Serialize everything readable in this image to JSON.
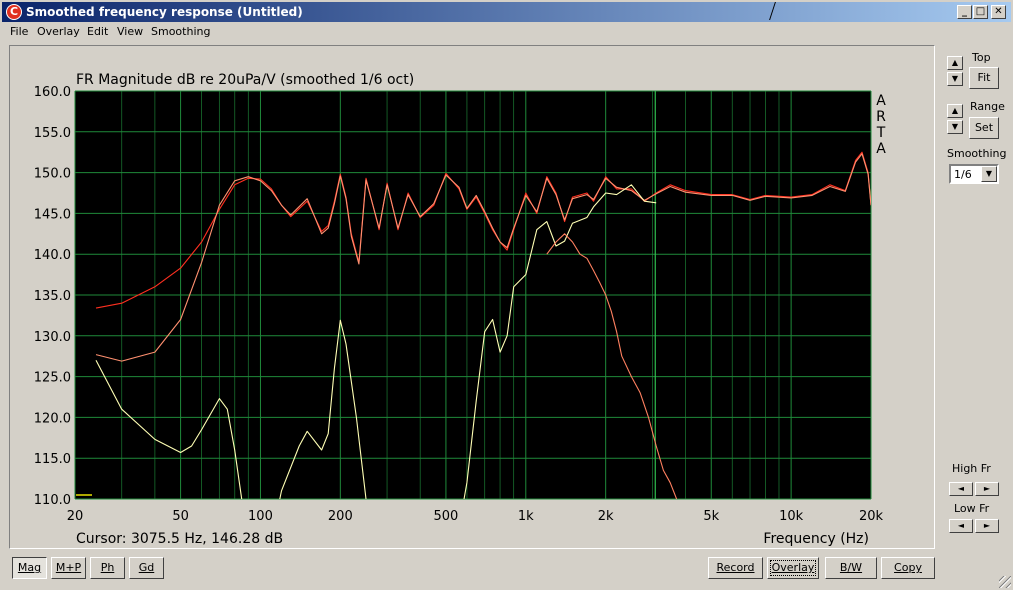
{
  "window": {
    "title": "Smoothed frequency response (Untitled)",
    "icon_letter": "C",
    "controls": {
      "minimize": "_",
      "maximize": "□",
      "close": "✕"
    }
  },
  "menu": [
    "File",
    "Overlay",
    "Edit",
    "View",
    "Smoothing"
  ],
  "side": {
    "top_label": "Top",
    "fit_label": "Fit",
    "range_label": "Range",
    "set_label": "Set",
    "smoothing_label": "Smoothing",
    "smoothing_value": "1/6",
    "high_fr_label": "High Fr",
    "low_fr_label": "Low Fr"
  },
  "status": {
    "cursor": "Cursor: 3075.5 Hz, 146.28 dB"
  },
  "bottom_buttons": {
    "mag": "Mag",
    "mp": "M+P",
    "ph": "Ph",
    "gd": "Gd",
    "record": "Record",
    "overlay": "Overlay",
    "bw": "B/W",
    "copy": "Copy"
  },
  "chart_data": {
    "type": "line",
    "title": "FR Magnitude dB re 20uPa/V (smoothed 1/6 oct)",
    "xlabel": "Frequency (Hz)",
    "ylabel": "",
    "watermark": [
      "A",
      "R",
      "T",
      "A"
    ],
    "x_scale": "log",
    "xlim": [
      20,
      20000
    ],
    "ylim": [
      110,
      160
    ],
    "x_ticks": [
      20,
      50,
      100,
      200,
      500,
      1000,
      2000,
      5000,
      10000,
      20000
    ],
    "x_tick_labels": [
      "20",
      "50",
      "100",
      "200",
      "500",
      "1k",
      "2k",
      "5k",
      "10k",
      "20k"
    ],
    "y_ticks": [
      160,
      155,
      150,
      145,
      140,
      135,
      130,
      125,
      120,
      115,
      110
    ],
    "y_tick_labels": [
      "160.0",
      "155.0",
      "150.0",
      "145.0",
      "140.0",
      "135.0",
      "130.0",
      "125.0",
      "120.0",
      "115.0",
      "110.0"
    ],
    "grid": true,
    "cursor_hz": 3075.5,
    "colors": {
      "background": "#000000",
      "grid": "#1f8a3a",
      "cursor": "#2fbf4f",
      "sum_main": "#ff3020",
      "sum_overlay": "#ff9070",
      "low_driver": "#ffffb4",
      "high_driver": "#ff8060"
    },
    "series": [
      {
        "color": "#ff3020",
        "x": [
          24,
          30,
          40,
          50,
          60,
          70,
          80,
          90,
          100,
          110,
          120,
          130,
          150,
          170,
          180,
          190,
          200,
          210,
          220,
          235,
          250,
          280,
          300,
          330,
          360,
          400,
          450,
          500,
          560,
          600,
          650,
          700,
          750,
          800,
          850,
          900,
          1000,
          1100,
          1200,
          1300,
          1400,
          1500,
          1700,
          1800,
          2000,
          2200,
          2500,
          2800,
          3100,
          3500,
          4000,
          5000,
          6000,
          7000,
          8000,
          10000,
          12000,
          14000,
          16000,
          17500,
          18500,
          19500,
          20000
        ],
        "y": [
          133.4,
          134,
          136,
          138.3,
          141.5,
          145.5,
          148.5,
          149.3,
          149.2,
          148,
          146,
          144.6,
          146.5,
          142.8,
          143.5,
          146.5,
          149.8,
          147,
          142.5,
          139,
          149.3,
          143,
          148.7,
          143,
          147.5,
          144.5,
          146,
          149.9,
          148,
          145.5,
          147,
          145,
          143,
          141.5,
          140.5,
          143,
          147.5,
          145,
          149.5,
          147.5,
          144,
          147,
          147.5,
          146.5,
          149.5,
          148,
          148,
          146.5,
          147.5,
          148.5,
          147.8,
          147.3,
          147.3,
          146.7,
          147.2,
          147,
          147.3,
          148.5,
          147.8,
          151.5,
          152.5,
          150,
          146
        ]
      },
      {
        "color": "#ff9070",
        "x": [
          24,
          30,
          40,
          50,
          60,
          70,
          80,
          90,
          100,
          110,
          120,
          130,
          150,
          170,
          180,
          190,
          200,
          210,
          220,
          235,
          250,
          280,
          300,
          330,
          360,
          400,
          450,
          500,
          560,
          600,
          650,
          700,
          750,
          800,
          850,
          900,
          1000,
          1100,
          1200,
          1300,
          1400,
          1500,
          1700,
          1800,
          2000,
          2200,
          2500,
          2800,
          3100,
          3500,
          4000,
          5000,
          6000,
          7000,
          8000,
          10000,
          12000,
          14000,
          16000,
          17500,
          18500,
          19500,
          20000
        ],
        "y": [
          127.7,
          126.9,
          128,
          132,
          139,
          146,
          149,
          149.5,
          149,
          147.8,
          146,
          144.8,
          146.8,
          142.5,
          143.2,
          146.2,
          149.6,
          146.8,
          142.2,
          138.8,
          149.1,
          143.2,
          148.5,
          143.2,
          147.3,
          144.6,
          146.2,
          149.7,
          148.2,
          145.6,
          147.2,
          145.2,
          143.2,
          141.5,
          140.8,
          143.2,
          147.2,
          145.2,
          149.3,
          147.3,
          144.2,
          146.8,
          147.3,
          146.7,
          149.3,
          148.2,
          147.8,
          146.6,
          147.4,
          148.3,
          147.6,
          147.2,
          147.2,
          146.6,
          147.1,
          146.9,
          147.2,
          148.3,
          147.7,
          151.3,
          152.3,
          149.8,
          146
        ]
      },
      {
        "color": "#ffffb4",
        "x": [
          24,
          30,
          40,
          50,
          55,
          60,
          70,
          75,
          80,
          85,
          90,
          95,
          100,
          110,
          120,
          140,
          150,
          170,
          180,
          190,
          200,
          210,
          230,
          250,
          280,
          300,
          350,
          400,
          450,
          500,
          550,
          600,
          650,
          700,
          750,
          800,
          850,
          900,
          1000,
          1100,
          1200,
          1300,
          1400,
          1500,
          1700,
          1800,
          2000,
          2200,
          2500,
          2800,
          3100
        ],
        "y": [
          127,
          121,
          117.3,
          115.7,
          116.5,
          118.5,
          122.3,
          121,
          116,
          110,
          104,
          100,
          100,
          105,
          111,
          116.5,
          118.3,
          116,
          118,
          126,
          131.9,
          129,
          120,
          110,
          100,
          100,
          100,
          100,
          100,
          100,
          105,
          112,
          122,
          130.5,
          132,
          128,
          130,
          136,
          137.5,
          143,
          144,
          141,
          141.6,
          143.8,
          144.5,
          145.8,
          147.5,
          147.3,
          148.5,
          146.5,
          146.3
        ]
      },
      {
        "color": "#ff8060",
        "x": [
          1200,
          1300,
          1400,
          1500,
          1600,
          1700,
          1800,
          1900,
          2000,
          2100,
          2200,
          2300,
          2500,
          2700,
          2900,
          3100,
          3300,
          3500,
          3700,
          4000,
          4500
        ],
        "y": [
          140,
          141.5,
          142.5,
          141.5,
          140,
          139.5,
          138,
          136.5,
          135,
          133,
          130.5,
          127.5,
          125,
          123,
          120,
          116.5,
          113.5,
          112,
          110,
          107,
          104
        ]
      }
    ]
  }
}
